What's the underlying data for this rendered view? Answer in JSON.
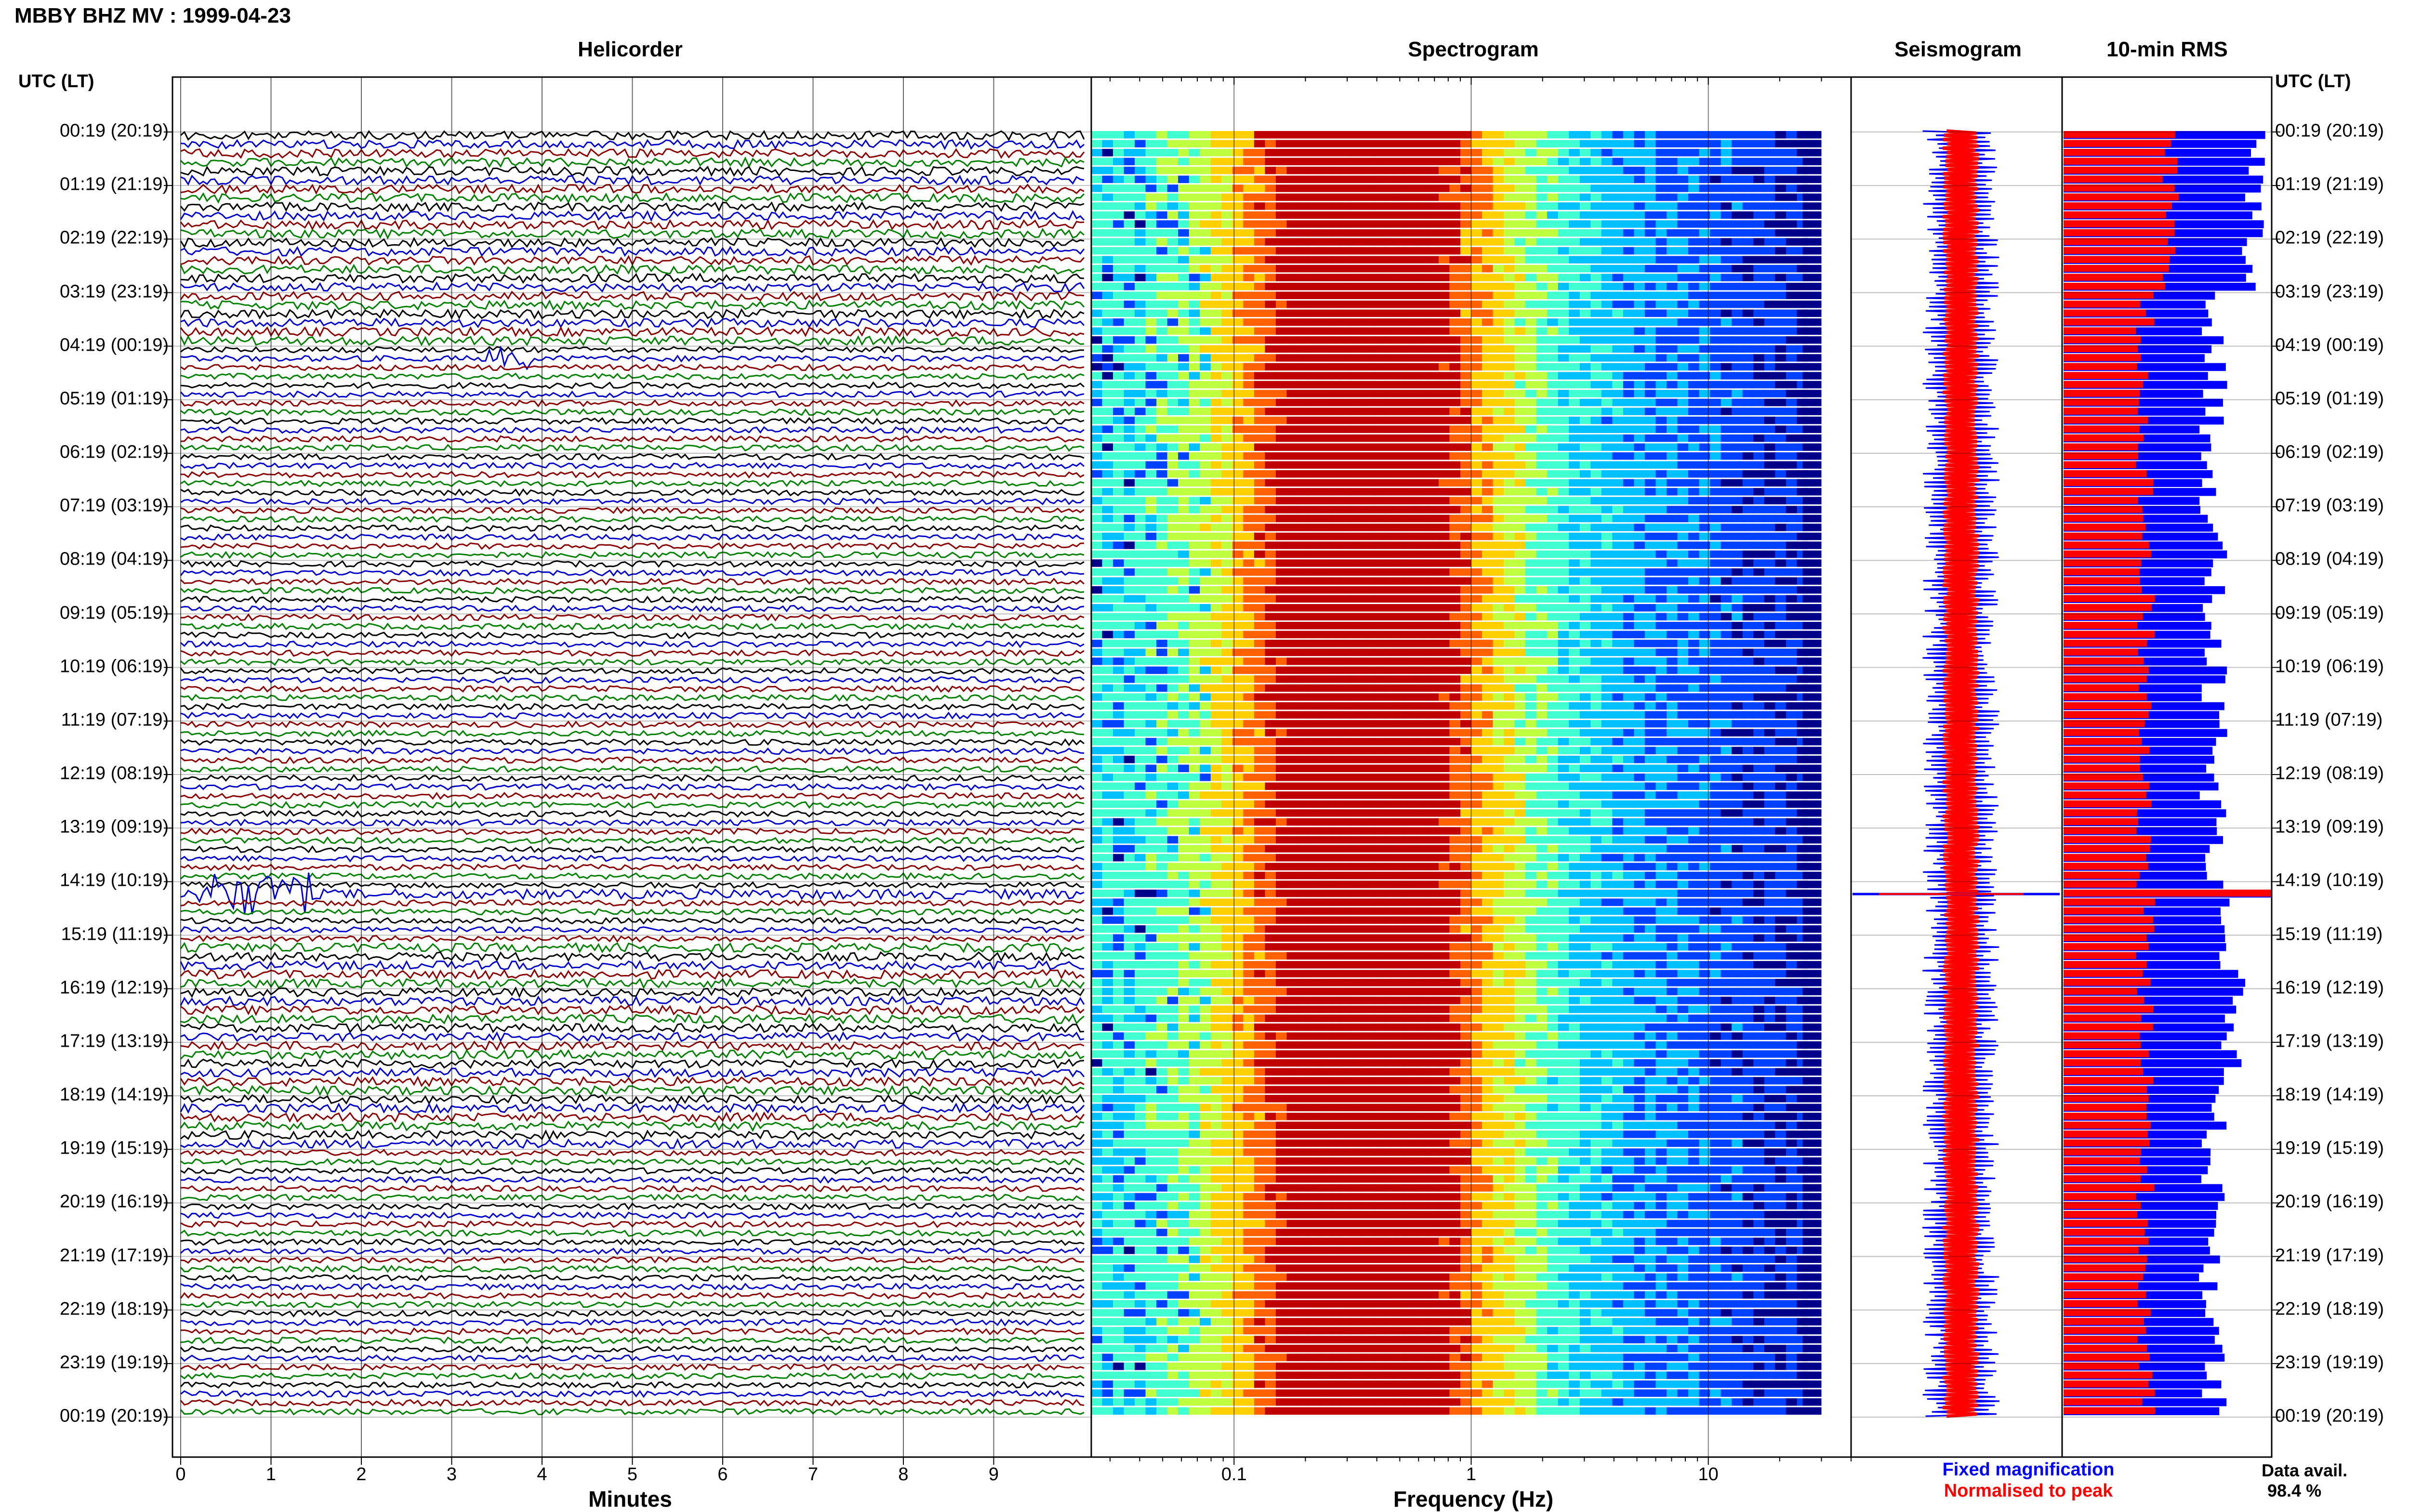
{
  "header": {
    "title": "MBBY BHZ MV : 1999-04-23"
  },
  "panels": {
    "helicorder": "Helicorder",
    "spectrogram": "Spectrogram",
    "seismogram": "Seismogram",
    "rms": "10-min RMS"
  },
  "time_axis": {
    "left_header": "UTC (LT)",
    "right_header": "UTC (LT)",
    "labels": [
      "00:19 (20:19)",
      "01:19 (21:19)",
      "02:19 (22:19)",
      "03:19 (23:19)",
      "04:19 (00:19)",
      "05:19 (01:19)",
      "06:19 (02:19)",
      "07:19 (03:19)",
      "08:19 (04:19)",
      "09:19 (05:19)",
      "10:19 (06:19)",
      "11:19 (07:19)",
      "12:19 (08:19)",
      "13:19 (09:19)",
      "14:19 (10:19)",
      "15:19 (11:19)",
      "16:19 (12:19)",
      "17:19 (13:19)",
      "18:19 (14:19)",
      "19:19 (15:19)",
      "20:19 (16:19)",
      "21:19 (17:19)",
      "22:19 (18:19)",
      "23:19 (19:19)",
      "00:19 (20:19)"
    ]
  },
  "legend": {
    "fixed": "Fixed magnification",
    "normalised": "Normalised to peak",
    "fixed_color": "#0000ff",
    "normalised_color": "#ff0000"
  },
  "availability": {
    "label": "Data avail.",
    "value": "98.4 %"
  },
  "colors": {
    "trace_cycle": [
      "#000000",
      "#0000cc",
      "#8b0000",
      "#008000"
    ],
    "spectrogram_scale": [
      "#00008b",
      "#0040ff",
      "#00c0ff",
      "#40ffd0",
      "#c0ff40",
      "#ffd000",
      "#ff6000",
      "#c00000"
    ]
  },
  "chart_data": [
    {
      "type": "line",
      "panel": "helicorder",
      "description_of_scale": "10-minute lines, one per row, 144 rows over 24 hours",
      "x_ticks": [
        "0",
        "1",
        "2",
        "3",
        "4",
        "5",
        "6",
        "7",
        "8",
        "9"
      ],
      "xlabel": "Minutes",
      "xlim": [
        0,
        10
      ],
      "rows": 144,
      "events": [
        {
          "row_time_utc": "04:19",
          "minute": 3.6,
          "note": "small event"
        },
        {
          "row_time_utc": "14:19",
          "minute_start": 0.3,
          "minute_end": 10,
          "note": "large event"
        }
      ]
    },
    {
      "type": "heatmap",
      "panel": "spectrogram",
      "x_scale": "log",
      "x_ticks": [
        "0.1",
        "1",
        "10"
      ],
      "xlabel": "Frequency (Hz)",
      "xlim": [
        0.025,
        40
      ],
      "peak_frequency_hz": 0.35,
      "rows": 144
    },
    {
      "type": "line",
      "panel": "seismogram",
      "series": [
        {
          "name": "Fixed magnification",
          "color": "#0000ff"
        },
        {
          "name": "Normalised to peak",
          "color": "#ff0000"
        }
      ]
    },
    {
      "type": "bar",
      "panel": "rms",
      "orientation": "horizontal",
      "rows": 144,
      "series": [
        {
          "name": "Fixed magnification",
          "color": "#0000ff"
        },
        {
          "name": "Normalised to peak",
          "color": "#ff0000"
        }
      ]
    }
  ]
}
